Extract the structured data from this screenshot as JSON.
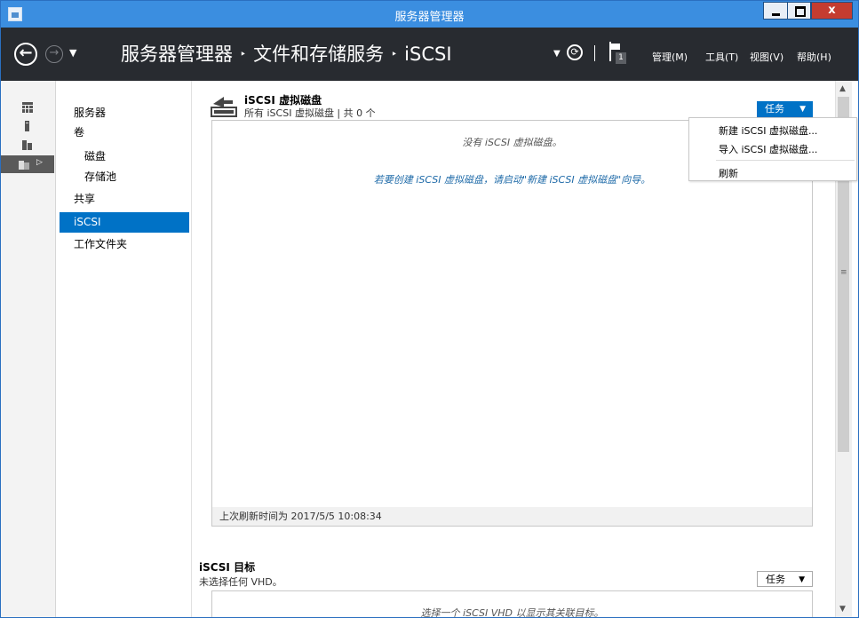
{
  "window": {
    "title": "服务器管理器",
    "close_label": "x"
  },
  "nav": {
    "back_glyph": "←",
    "forward_glyph": "→",
    "breadcrumb": [
      "服务器管理器",
      "文件和存储服务",
      "iSCSI"
    ],
    "breadcrumb_sep": "‣",
    "notification_count": "1",
    "menus": [
      "管理(M)",
      "工具(T)",
      "视图(V)",
      "帮助(H)"
    ]
  },
  "rail": {
    "icons": [
      "dashboard-icon",
      "local-server-icon",
      "all-servers-icon",
      "file-storage-icon"
    ]
  },
  "subnav": {
    "items": [
      "服务器",
      "卷",
      "磁盘",
      "存储池",
      "共享",
      "iSCSI",
      "工作文件夹"
    ]
  },
  "section1": {
    "title": "iSCSI 虚拟磁盘",
    "subtitle": "所有 iSCSI 虚拟磁盘 | 共 0 个",
    "task_label": "任务",
    "empty_msg": "没有 iSCSI 虚拟磁盘。",
    "hint_msg": "若要创建 iSCSI 虚拟磁盘，请启动\"新建 iSCSI 虚拟磁盘\"向导。",
    "footer": "上次刷新时间为 2017/5/5 10:08:34"
  },
  "dropdown": {
    "items": [
      "新建 iSCSI 虚拟磁盘...",
      "导入 iSCSI 虚拟磁盘...",
      "刷新"
    ]
  },
  "section2": {
    "title": "iSCSI 目标",
    "subtitle": "未选择任何 VHD。",
    "task_label": "任务",
    "msg": "选择一个 iSCSI VHD 以显示其关联目标。"
  },
  "colors": {
    "titlebar": "#3b8ee0",
    "navbar": "#282b30",
    "accent": "#0072c6",
    "close": "#c43c30"
  }
}
